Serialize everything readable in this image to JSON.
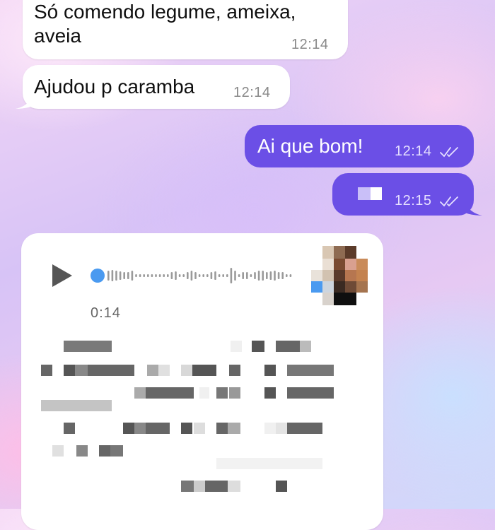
{
  "messages": [
    {
      "text_line1": "Só comendo legume, ameixa,",
      "text_line2": "aveia",
      "time": "12:14",
      "direction": "incoming"
    },
    {
      "text": "Ajudou p caramba",
      "time": "12:14",
      "direction": "incoming"
    },
    {
      "text": "Ai que bom!",
      "time": "12:14",
      "direction": "outgoing",
      "status": "read-double-check-icon"
    },
    {
      "text": "",
      "time": "12:15",
      "direction": "outgoing",
      "status": "read-double-check-icon"
    }
  ],
  "voice_message": {
    "duration": "0:14",
    "play_icon": "play-icon",
    "progress": 0.0,
    "transcript_redacted": true
  },
  "colors": {
    "outgoing_bubble": "#6b4fe6",
    "incoming_bubble": "#ffffff",
    "waveform_played": "#4a9af0",
    "waveform": "#9a9a9a"
  }
}
